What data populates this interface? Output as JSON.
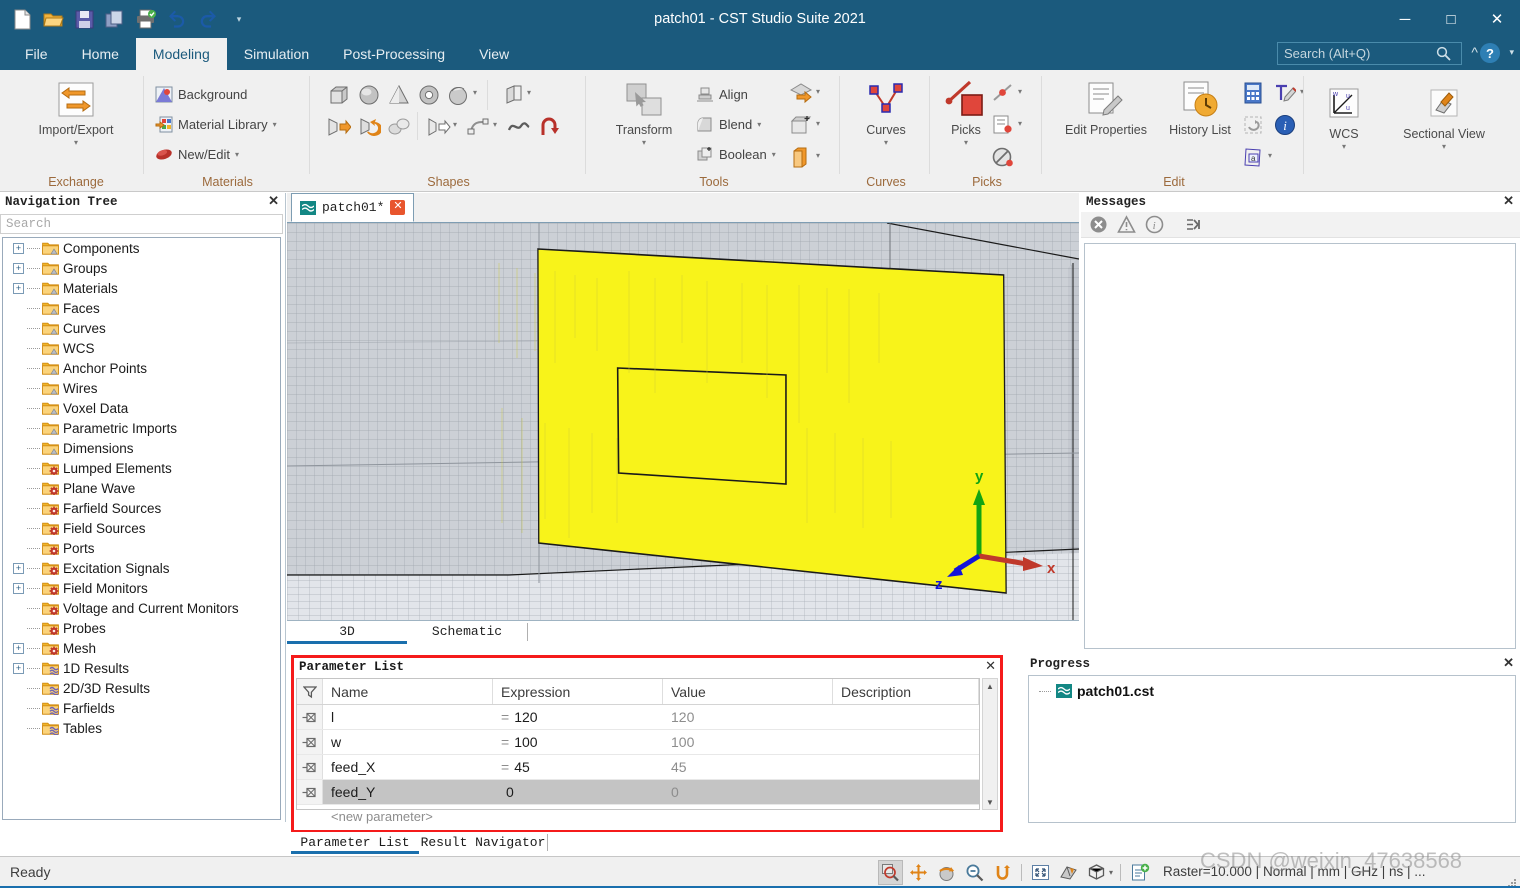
{
  "window": {
    "title": "patch01 - CST Studio Suite 2021",
    "minimize": "─",
    "maximize": "□",
    "close": "✕"
  },
  "quick_access": [
    {
      "name": "new-file-icon",
      "tip": "New"
    },
    {
      "name": "open-folder-icon",
      "tip": "Open"
    },
    {
      "name": "save-icon",
      "tip": "Save"
    },
    {
      "name": "copy-icon",
      "tip": "Copy"
    },
    {
      "name": "print-icon",
      "tip": "Print"
    },
    {
      "name": "undo-icon",
      "tip": "Undo"
    },
    {
      "name": "redo-icon",
      "tip": "Redo"
    },
    {
      "name": "customize-caret-icon",
      "tip": "Customize"
    }
  ],
  "ribbon_tabs": [
    {
      "label": "File",
      "active": false
    },
    {
      "label": "Home",
      "active": false
    },
    {
      "label": "Modeling",
      "active": true
    },
    {
      "label": "Simulation",
      "active": false
    },
    {
      "label": "Post-Processing",
      "active": false
    },
    {
      "label": "View",
      "active": false
    }
  ],
  "search": {
    "placeholder": "Search (Alt+Q)",
    "value": "",
    "icon": "search-icon"
  },
  "ribbon": {
    "groups": [
      {
        "label": "Exchange",
        "big": {
          "label": "Import/Export",
          "caret": "▾"
        }
      },
      {
        "label": "Materials",
        "items": [
          {
            "label": "Background",
            "caret": ""
          },
          {
            "label": "Material Library",
            "caret": "▾"
          },
          {
            "label": "New/Edit",
            "caret": "▾"
          }
        ]
      },
      {
        "label": "Shapes"
      },
      {
        "label": "Tools",
        "big": {
          "label": "Transform",
          "caret": "▾"
        },
        "items": [
          {
            "label": "Align",
            "caret": ""
          },
          {
            "label": "Blend",
            "caret": "▾"
          },
          {
            "label": "Boolean",
            "caret": "▾"
          }
        ]
      },
      {
        "label": "Curves",
        "big": {
          "label": "Curves",
          "caret": "▾"
        }
      },
      {
        "label": "Picks",
        "big": {
          "label": "Picks",
          "caret": "▾"
        }
      },
      {
        "label": "Edit",
        "big": {
          "label": "Edit Properties",
          "caret": ""
        },
        "big2": {
          "label": "History List",
          "caret": ""
        }
      },
      {
        "label": "",
        "wcs": {
          "label": "WCS",
          "caret": "▾"
        },
        "sectional": {
          "label": "Sectional View",
          "caret": "▾"
        }
      }
    ]
  },
  "navigation_tree": {
    "title": "Navigation Tree",
    "close": "✕",
    "search_placeholder": "Search",
    "search_value": "",
    "items": [
      {
        "label": "Components",
        "expandable": true,
        "kind": "model"
      },
      {
        "label": "Groups",
        "expandable": true,
        "kind": "model"
      },
      {
        "label": "Materials",
        "expandable": true,
        "kind": "model"
      },
      {
        "label": "Faces",
        "expandable": false,
        "kind": "model"
      },
      {
        "label": "Curves",
        "expandable": false,
        "kind": "model"
      },
      {
        "label": "WCS",
        "expandable": false,
        "kind": "model"
      },
      {
        "label": "Anchor Points",
        "expandable": false,
        "kind": "model"
      },
      {
        "label": "Wires",
        "expandable": false,
        "kind": "model"
      },
      {
        "label": "Voxel Data",
        "expandable": false,
        "kind": "model"
      },
      {
        "label": "Parametric Imports",
        "expandable": false,
        "kind": "model"
      },
      {
        "label": "Dimensions",
        "expandable": false,
        "kind": "model"
      },
      {
        "label": "Lumped Elements",
        "expandable": false,
        "kind": "sim"
      },
      {
        "label": "Plane Wave",
        "expandable": false,
        "kind": "sim"
      },
      {
        "label": "Farfield Sources",
        "expandable": false,
        "kind": "sim"
      },
      {
        "label": "Field Sources",
        "expandable": false,
        "kind": "sim"
      },
      {
        "label": "Ports",
        "expandable": false,
        "kind": "sim"
      },
      {
        "label": "Excitation Signals",
        "expandable": true,
        "kind": "sim"
      },
      {
        "label": "Field Monitors",
        "expandable": true,
        "kind": "sim"
      },
      {
        "label": "Voltage and Current Monitors",
        "expandable": false,
        "kind": "sim"
      },
      {
        "label": "Probes",
        "expandable": false,
        "kind": "sim"
      },
      {
        "label": "Mesh",
        "expandable": true,
        "kind": "sim"
      },
      {
        "label": "1D Results",
        "expandable": true,
        "kind": "result"
      },
      {
        "label": "2D/3D Results",
        "expandable": false,
        "kind": "result"
      },
      {
        "label": "Farfields",
        "expandable": false,
        "kind": "result"
      },
      {
        "label": "Tables",
        "expandable": false,
        "kind": "result"
      }
    ]
  },
  "document": {
    "tab_label": "patch01*",
    "tab_close": "✕",
    "view_tabs": [
      {
        "label": "3D",
        "active": true
      },
      {
        "label": "Schematic",
        "active": false
      }
    ],
    "axes": {
      "x": "x",
      "y": "y",
      "z": "z",
      "x_color": "#e01b1b",
      "y_color": "#12a412",
      "z_color": "#1414d8"
    },
    "patch_color": "#f8f31a",
    "background_color": "#ccd0d6"
  },
  "messages": {
    "title": "Messages",
    "close": "✕",
    "toolbar": [
      {
        "name": "error-icon"
      },
      {
        "name": "warning-icon"
      },
      {
        "name": "info-icon"
      },
      {
        "name": "clear-messages-icon"
      }
    ],
    "content": ""
  },
  "parameter_list": {
    "title": "Parameter List",
    "close": "✕",
    "filter_icon": "filter-icon",
    "columns": [
      "Name",
      "Expression",
      "Value",
      "Description"
    ],
    "rows": [
      {
        "name": "l",
        "eq": "=",
        "expression": "120",
        "value": "120",
        "description": "",
        "selected": false
      },
      {
        "name": "w",
        "eq": "=",
        "expression": "100",
        "value": "100",
        "description": "",
        "selected": false
      },
      {
        "name": "feed_X",
        "eq": "=",
        "expression": "45",
        "value": "45",
        "description": "",
        "selected": false
      },
      {
        "name": "feed_Y",
        "eq": "",
        "expression": "0",
        "value": "0",
        "description": "",
        "selected": true
      }
    ],
    "new_parameter_label": "<new parameter>",
    "tabs": [
      {
        "label": "Parameter List",
        "active": true
      },
      {
        "label": "Result Navigator",
        "active": false
      }
    ],
    "highlight_color": "#f51b1b"
  },
  "progress": {
    "title": "Progress",
    "close": "✕",
    "items": [
      {
        "label": "patch01.cst",
        "icon": "cst-file-icon"
      }
    ]
  },
  "status_bar": {
    "ready": "Ready",
    "info": "Raster=10.000 | Normal | mm | GHz | ns | ...",
    "tools": [
      {
        "name": "zoom-tool-icon",
        "pressed": true
      },
      {
        "name": "pan-tool-icon",
        "pressed": false
      },
      {
        "name": "rotate-tool-icon",
        "pressed": false
      },
      {
        "name": "zoom-out-tool-icon",
        "pressed": false
      },
      {
        "name": "rotate-view-plane-icon",
        "pressed": false
      },
      {
        "name": "fit-to-screen-icon",
        "pressed": false
      },
      {
        "name": "perspective-view-icon",
        "pressed": false
      },
      {
        "name": "view-cube-icon",
        "pressed": false
      },
      {
        "name": "add-snap-icon",
        "pressed": false
      }
    ],
    "watermark": "CSDN @weixin_47638568"
  }
}
